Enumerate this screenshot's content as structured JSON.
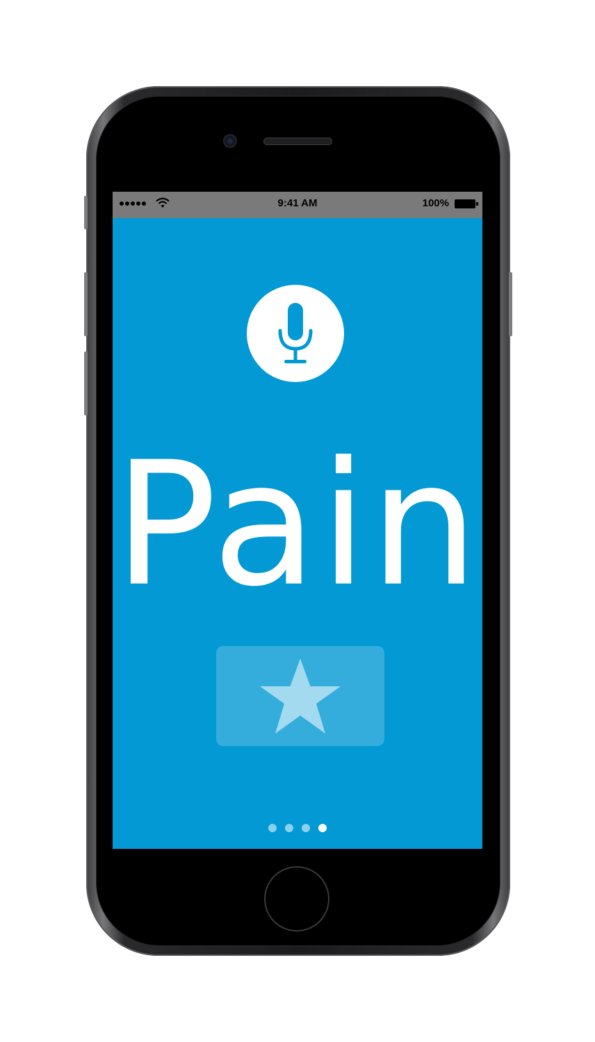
{
  "status_bar": {
    "time": "9:41 AM",
    "battery": "100%",
    "signal_icon": "signal-dots-icon",
    "wifi_icon": "wifi-icon",
    "battery_icon": "battery-icon"
  },
  "main": {
    "mic_icon": "microphone-icon",
    "word": "Pain",
    "favorite_icon": "star-icon"
  },
  "page_indicator": {
    "count": 4,
    "active_index": 3
  },
  "colors": {
    "screen_background": "#0299d4",
    "status_bar": "#7a7a7a",
    "text": "#ffffff"
  }
}
